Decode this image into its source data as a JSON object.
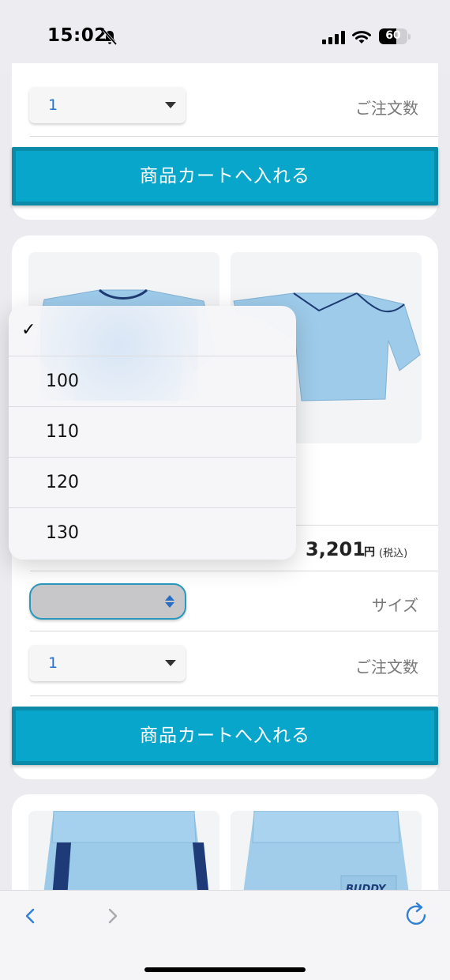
{
  "status_bar": {
    "time": "15:02",
    "battery": "60",
    "battery_level": 0.6,
    "icons": [
      "bell-slash-icon",
      "cellular-signal-icon",
      "wifi-icon",
      "battery-icon"
    ]
  },
  "top_card": {
    "quantity_value": "1",
    "quantity_label": "ご注文数",
    "cart_button": "商品カートへ入れる"
  },
  "main_card": {
    "price": "3,201",
    "price_unit": "円",
    "tax_note": "(税込)",
    "size_label": "サイズ",
    "size_value": "",
    "quantity_value": "1",
    "quantity_label": "ご注文数",
    "cart_button": "商品カートへ入れる",
    "photos": [
      "sweatshirt-front-photo",
      "sweatshirt-back-photo"
    ]
  },
  "size_dropdown": {
    "selected_mark": "✓",
    "options": [
      "100",
      "110",
      "120",
      "130"
    ]
  },
  "bottom_card": {
    "photos": [
      "pants-front-photo",
      "pants-back-photo"
    ],
    "logo_text": "BUDDY"
  },
  "toolbar": {
    "icons": [
      "chevron-left-icon",
      "chevron-right-icon",
      "reload-icon"
    ]
  },
  "colors": {
    "accent": "#09a6cc",
    "link_blue": "#1f72d1",
    "background": "#ececf0"
  }
}
